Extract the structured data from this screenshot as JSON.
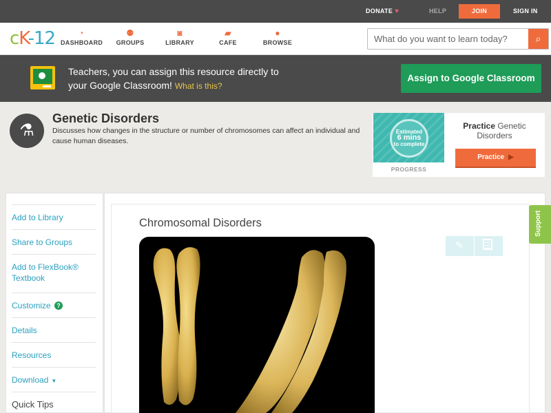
{
  "topbar": {
    "donate": "DONATE",
    "help": "HELP",
    "join": "JOIN",
    "signin": "SIGN IN"
  },
  "brand": {
    "logo_c": "c",
    "logo_k": "K",
    "logo_dash": "-",
    "logo_12": "12",
    "accent_color": "#f06b3c"
  },
  "nav": {
    "items": [
      {
        "label": "DASHBOARD",
        "icon": "gauge-icon"
      },
      {
        "label": "GROUPS",
        "icon": "people-icon"
      },
      {
        "label": "LIBRARY",
        "icon": "backpack-icon"
      },
      {
        "label": "CAFE",
        "icon": "chat-icon"
      },
      {
        "label": "BROWSE",
        "icon": "lightbulb-icon"
      }
    ],
    "search_placeholder": "What do you want to learn today?"
  },
  "classroom": {
    "text_line1": "Teachers, you can assign this resource directly to",
    "text_line2": "your Google Classroom!",
    "what_link": "What is this?",
    "button": "Assign to Google Classroom",
    "button_color": "#1e9c58"
  },
  "concept": {
    "title": "Genetic Disorders",
    "description": "Discusses how changes in the structure or number of chromosomes can affect an individual and cause human diseases."
  },
  "practice": {
    "estimated_line1": "Estimated",
    "estimated_line2": "6 mins",
    "estimated_line3": "to complete",
    "progress_label": "PROGRESS",
    "label_bold": "Practice",
    "label_rest": "Genetic Disorders",
    "button": "Practice"
  },
  "sidebar": {
    "items": [
      {
        "label": "Add to Library"
      },
      {
        "label": "Share to Groups"
      },
      {
        "label": "Add to FlexBook® Textbook"
      },
      {
        "label": "Customize"
      },
      {
        "label": "Details"
      },
      {
        "label": "Resources"
      },
      {
        "label": "Download"
      }
    ],
    "quick_tips": "Quick Tips"
  },
  "main": {
    "heading": "Chromosomal Disorders"
  },
  "support": "Support"
}
